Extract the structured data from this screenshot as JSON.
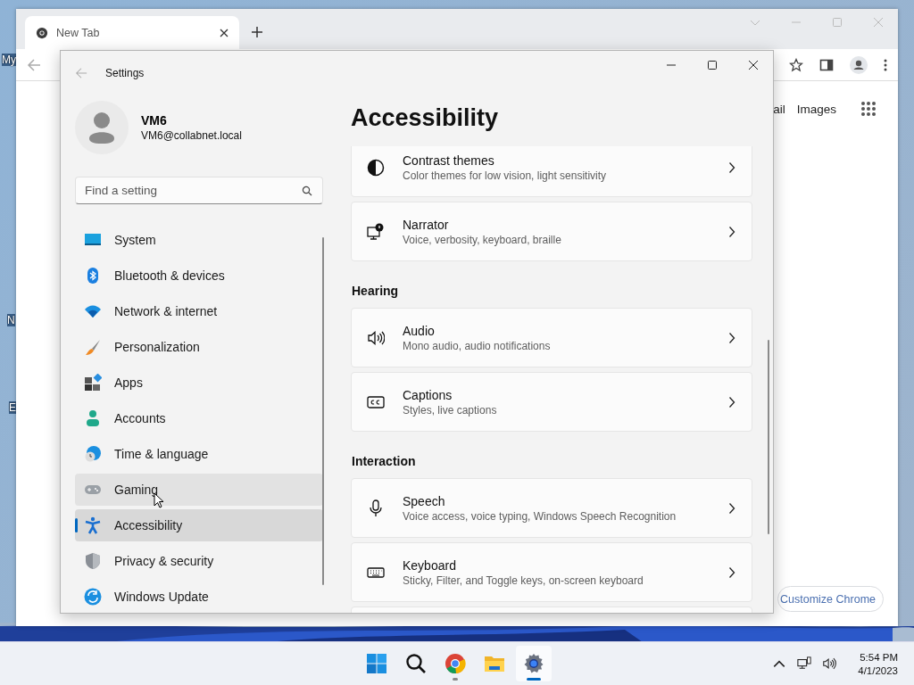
{
  "desktop": {
    "icon_labels": [
      "My",
      "N",
      "E"
    ]
  },
  "browser": {
    "tab": {
      "title": "New Tab",
      "selected": true
    },
    "links": [
      "ail",
      "Images"
    ],
    "customize_button": "Customize Chrome"
  },
  "settings": {
    "title": "Settings",
    "user": {
      "name": "VM6",
      "email": "VM6@collabnet.local"
    },
    "search": {
      "placeholder": "Find a setting"
    },
    "nav": [
      {
        "label": "System",
        "selected": false,
        "hovered": false
      },
      {
        "label": "Bluetooth & devices",
        "selected": false,
        "hovered": false
      },
      {
        "label": "Network & internet",
        "selected": false,
        "hovered": false
      },
      {
        "label": "Personalization",
        "selected": false,
        "hovered": false
      },
      {
        "label": "Apps",
        "selected": false,
        "hovered": false
      },
      {
        "label": "Accounts",
        "selected": false,
        "hovered": false
      },
      {
        "label": "Time & language",
        "selected": false,
        "hovered": false
      },
      {
        "label": "Gaming",
        "selected": false,
        "hovered": true
      },
      {
        "label": "Accessibility",
        "selected": true,
        "hovered": false
      },
      {
        "label": "Privacy & security",
        "selected": false,
        "hovered": false
      },
      {
        "label": "Windows Update",
        "selected": false,
        "hovered": false
      }
    ],
    "page_title": "Accessibility",
    "sections": [
      {
        "cards": [
          {
            "kind": "link",
            "title": "Contrast themes",
            "subtitle": "Color themes for low vision, light sensitivity"
          },
          {
            "kind": "link",
            "title": "Narrator",
            "subtitle": "Voice, verbosity, keyboard, braille"
          }
        ]
      },
      {
        "heading": "Hearing",
        "cards": [
          {
            "kind": "link",
            "title": "Audio",
            "subtitle": "Mono audio, audio notifications"
          },
          {
            "kind": "link",
            "title": "Captions",
            "subtitle": "Styles, live captions"
          }
        ]
      },
      {
        "heading": "Interaction",
        "cards": [
          {
            "kind": "link",
            "title": "Speech",
            "subtitle": "Voice access, voice typing, Windows Speech Recognition"
          },
          {
            "kind": "link",
            "title": "Keyboard",
            "subtitle": "Sticky, Filter, and Toggle keys, on-screen keyboard"
          },
          {
            "kind": "cut"
          }
        ]
      }
    ]
  },
  "taskbar": {
    "apps": [
      {
        "running": false,
        "active": false
      },
      {
        "running": false,
        "active": false
      },
      {
        "running": true,
        "active": false
      },
      {
        "running": false,
        "active": false
      },
      {
        "running": true,
        "active": true
      }
    ],
    "time": "5:54 PM",
    "date": "4/1/2023"
  }
}
